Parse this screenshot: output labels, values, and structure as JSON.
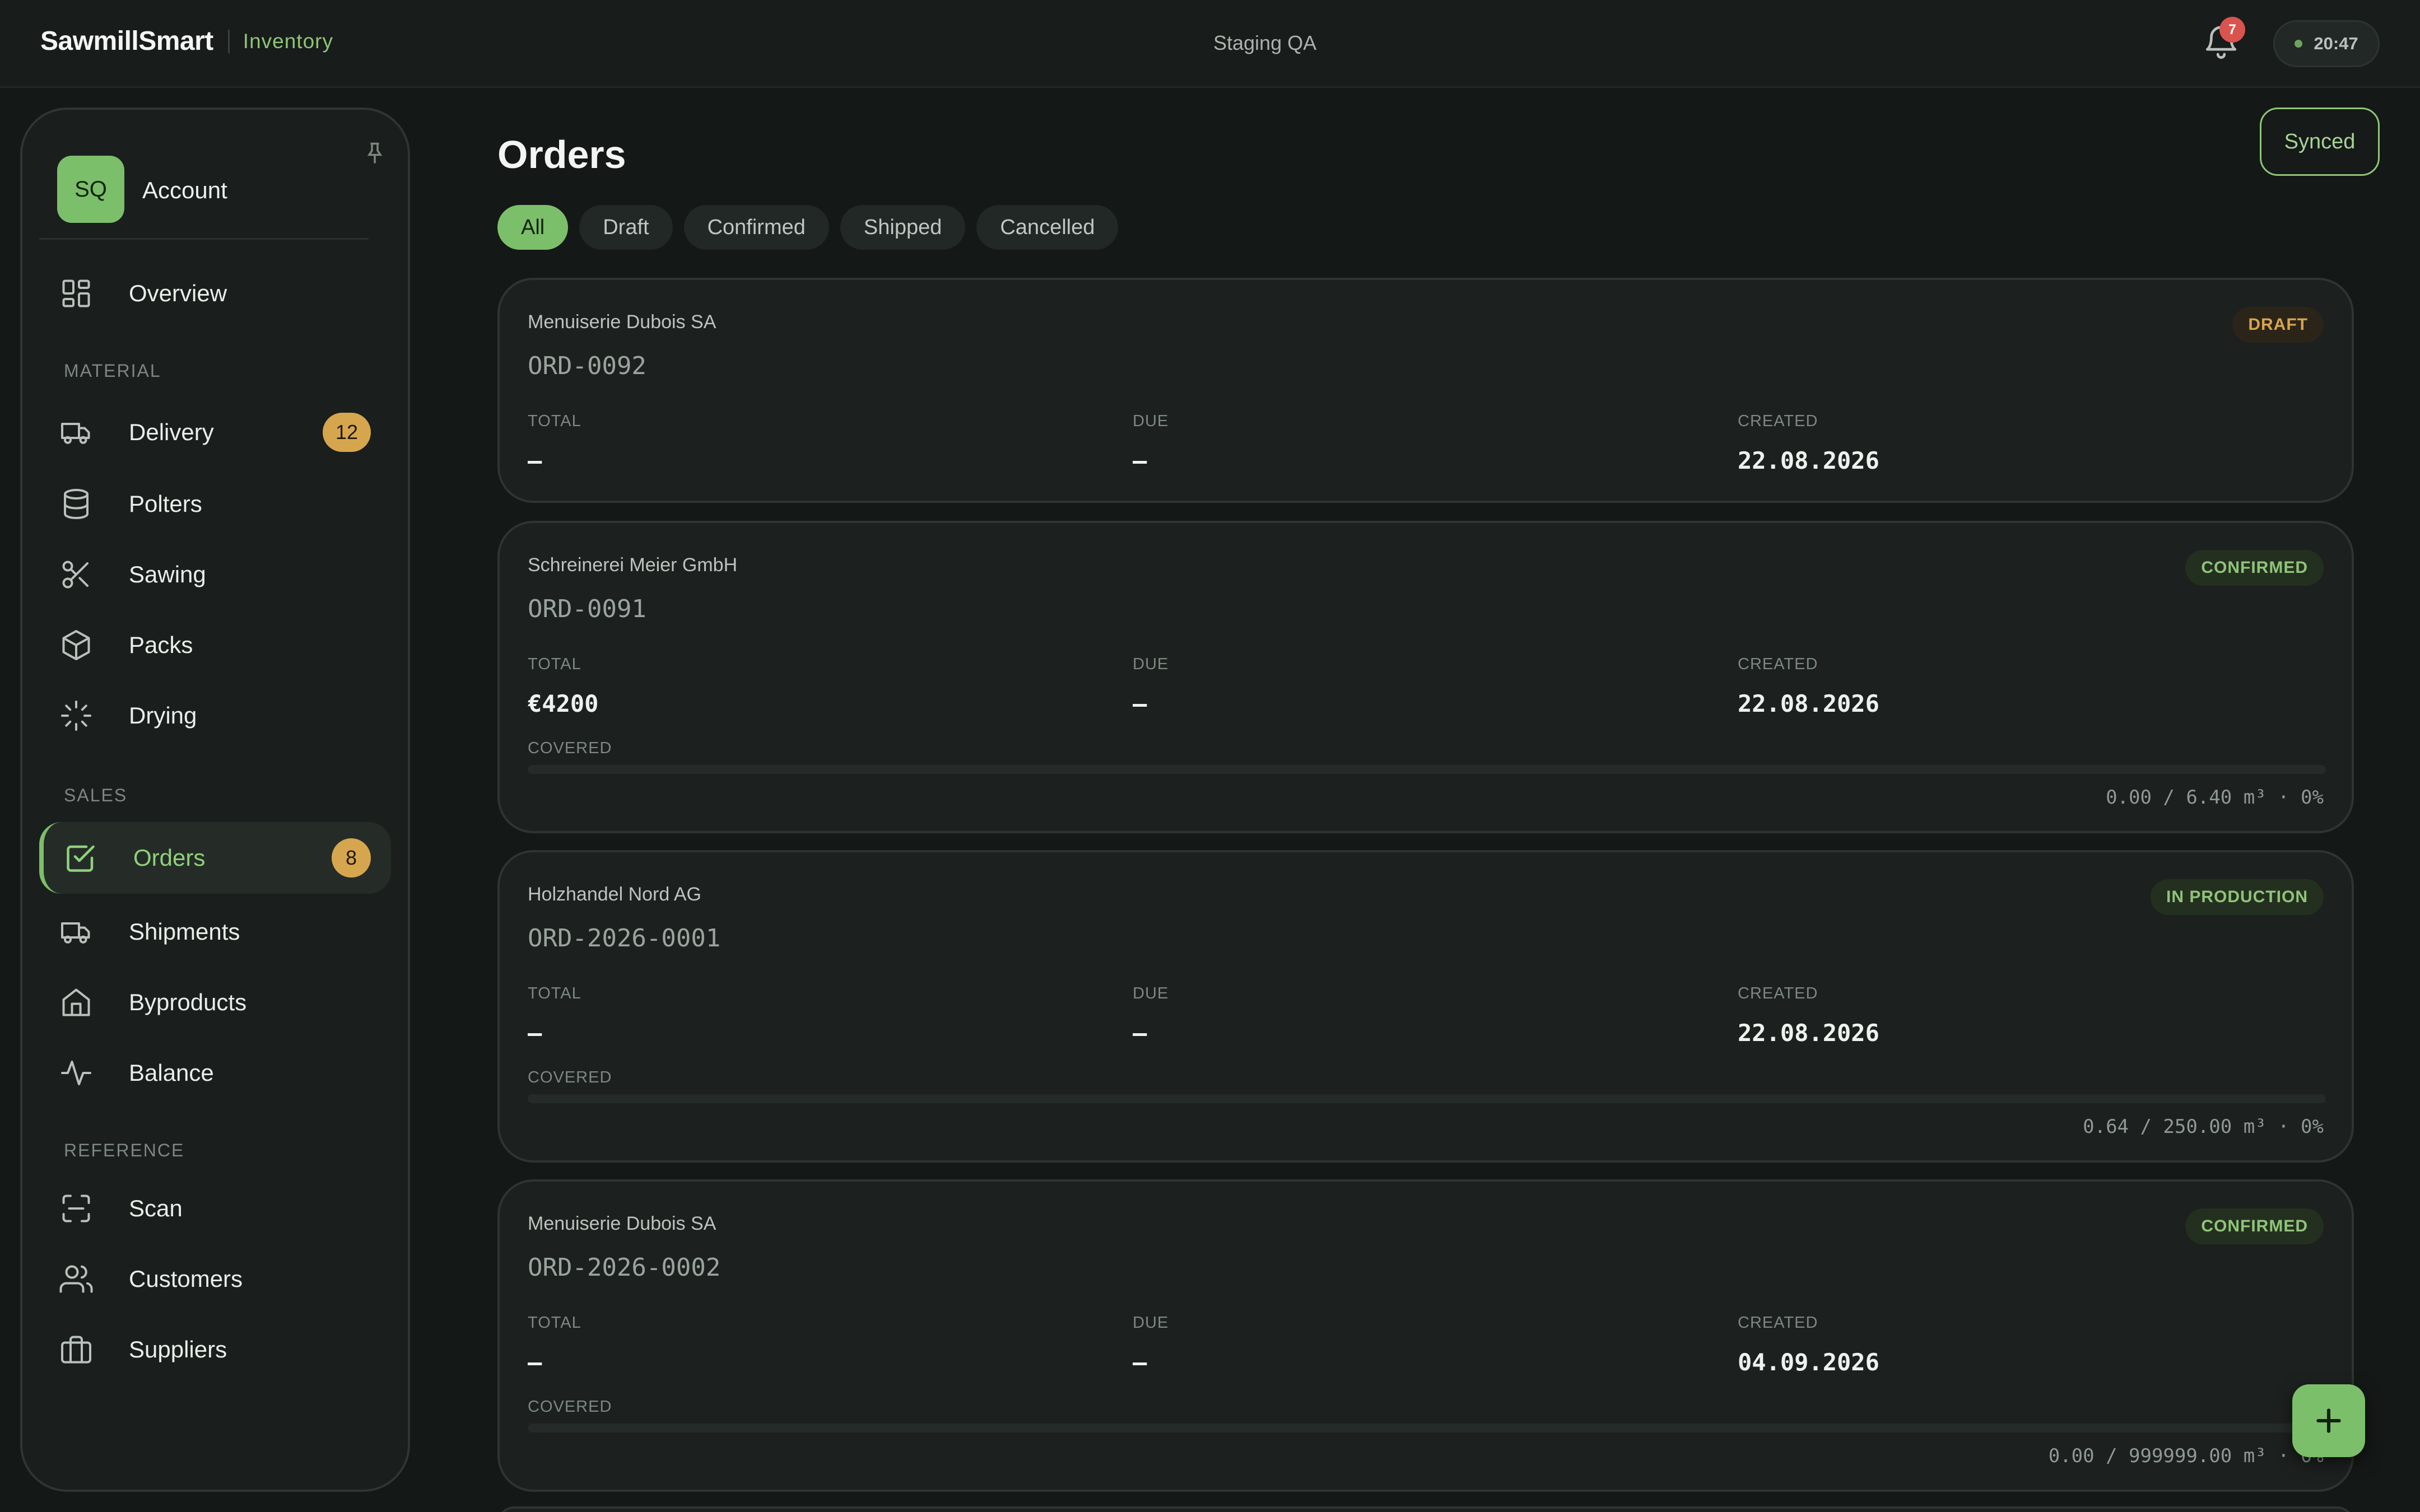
{
  "topbar": {
    "brand": "SawmillSmart",
    "module": "Inventory",
    "environment": "Staging QA",
    "notifications_count": "7",
    "clock": "20:47"
  },
  "sidebar": {
    "account": {
      "initials": "SQ",
      "label": "Account"
    },
    "overview": "Overview",
    "sections": {
      "material": "MATERIAL",
      "sales": "SALES",
      "reference": "REFERENCE"
    },
    "items": {
      "delivery": {
        "label": "Delivery",
        "count": "12"
      },
      "polters": {
        "label": "Polters"
      },
      "sawing": {
        "label": "Sawing"
      },
      "packs": {
        "label": "Packs"
      },
      "drying": {
        "label": "Drying"
      },
      "orders": {
        "label": "Orders",
        "count": "8"
      },
      "shipments": {
        "label": "Shipments"
      },
      "byproducts": {
        "label": "Byproducts"
      },
      "balance": {
        "label": "Balance"
      },
      "scan": {
        "label": "Scan"
      },
      "customers": {
        "label": "Customers"
      },
      "suppliers": {
        "label": "Suppliers"
      }
    }
  },
  "main": {
    "title": "Orders",
    "sync_status": "Synced",
    "filters": [
      "All",
      "Draft",
      "Confirmed",
      "Shipped",
      "Cancelled"
    ],
    "active_filter": "All",
    "labels": {
      "total": "TOTAL",
      "due": "DUE",
      "created": "CREATED",
      "covered": "COVERED"
    },
    "orders": [
      {
        "customer": "Menuiserie Dubois SA",
        "id": "ORD-0092",
        "status": "DRAFT",
        "total": "—",
        "due": "—",
        "created": "22.08.2026"
      },
      {
        "customer": "Schreinerei Meier GmbH",
        "id": "ORD-0091",
        "status": "CONFIRMED",
        "total": "€4200",
        "due": "—",
        "created": "22.08.2026",
        "covered": "0.00 / 6.40 m³ · 0%",
        "covered_pct": 0
      },
      {
        "customer": "Holzhandel Nord AG",
        "id": "ORD-2026-0001",
        "status": "IN PRODUCTION",
        "total": "—",
        "due": "—",
        "created": "22.08.2026",
        "covered": "0.64 / 250.00 m³ · 0%",
        "covered_pct": 0
      },
      {
        "customer": "Menuiserie Dubois SA",
        "id": "ORD-2026-0002",
        "status": "CONFIRMED",
        "total": "—",
        "due": "—",
        "created": "04.09.2026",
        "covered": "0.00 / 999999.00 m³ · 0%",
        "covered_pct": 0
      }
    ]
  },
  "colors": {
    "accent": "#7cbf6a",
    "badge_amber": "#d6a64e",
    "status_draft": "#d9a44f",
    "status_confirmed": "#8fc47a",
    "notification": "#d9534f"
  },
  "icons": {
    "notifications": "bell-icon",
    "new_order": "plus-icon",
    "pin": "pin-icon"
  }
}
